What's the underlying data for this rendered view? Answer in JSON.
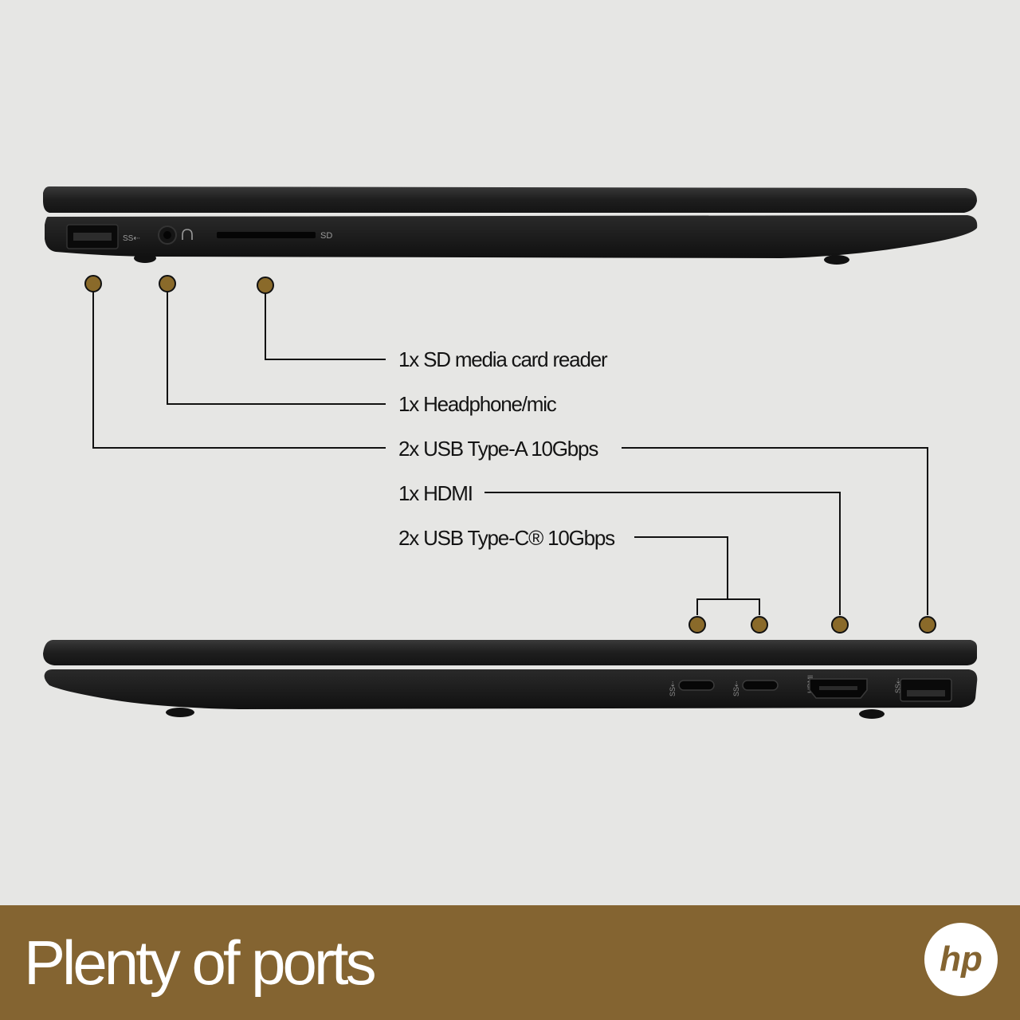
{
  "colors": {
    "background": "#e6e6e4",
    "accent": "#846431",
    "marker": "#8a6a2a",
    "laptop_body": "#1d1d1d",
    "text": "#141414"
  },
  "top_view": {
    "sd_marking": "SD"
  },
  "callouts": [
    {
      "id": "sd",
      "text": "1x SD media card reader"
    },
    {
      "id": "headphone",
      "text": "1x Headphone/mic"
    },
    {
      "id": "usb_a",
      "text": "2x USB Type-A 10Gbps"
    },
    {
      "id": "hdmi",
      "text": "1x HDMI"
    },
    {
      "id": "usb_c",
      "text": "2x USB Type-C® 10Gbps"
    }
  ],
  "bottom_view": {
    "hdmi_marking": "HDMI"
  },
  "footer": {
    "title": "Plenty of ports",
    "logo_text": "hp"
  },
  "icons": [
    "usb-symbol-icon",
    "headphone-icon",
    "hp-logo-icon"
  ]
}
